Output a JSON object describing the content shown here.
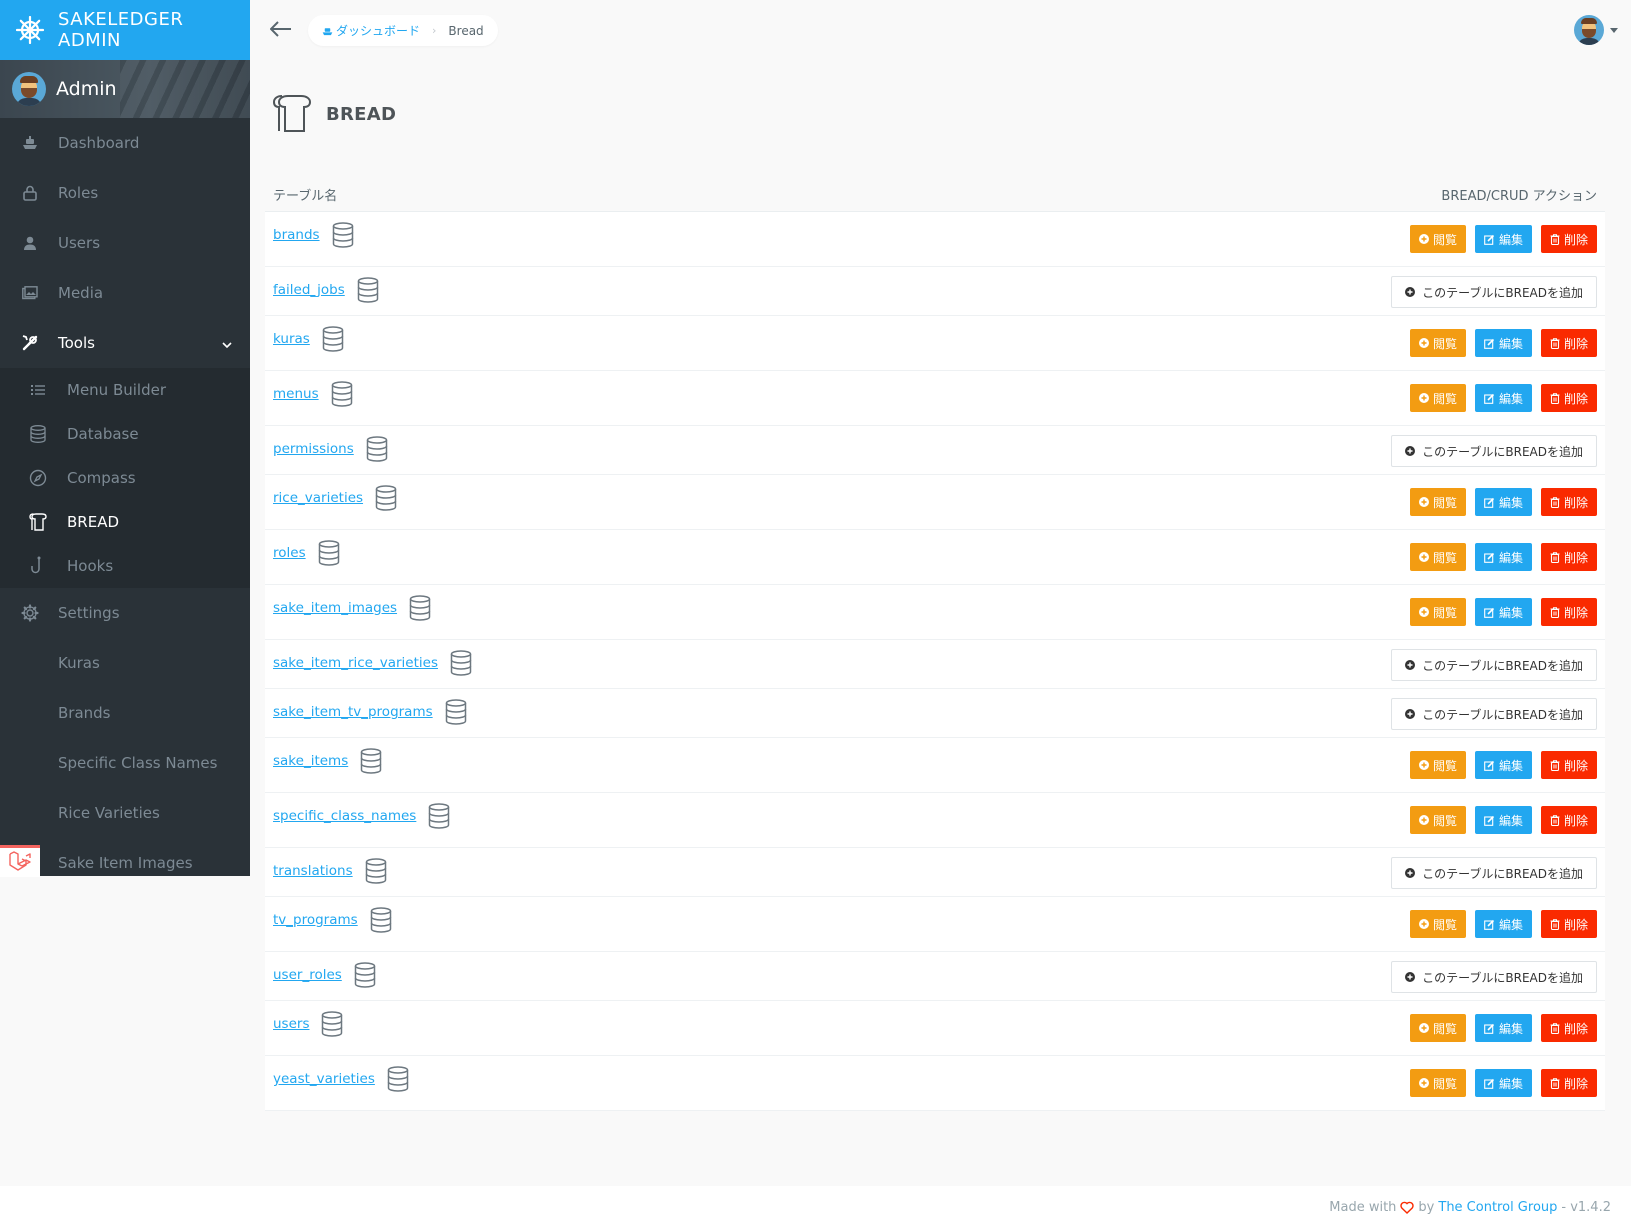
{
  "brand": {
    "title": "SAKELEDGER ADMIN"
  },
  "profile": {
    "name": "Admin"
  },
  "sidebar": {
    "items": [
      {
        "label": "Dashboard",
        "icon": "boat-icon"
      },
      {
        "label": "Roles",
        "icon": "lock-icon"
      },
      {
        "label": "Users",
        "icon": "person-icon"
      },
      {
        "label": "Media",
        "icon": "images-icon"
      },
      {
        "label": "Tools",
        "icon": "tools-icon"
      }
    ],
    "tools_sub": [
      {
        "label": "Menu Builder",
        "icon": "list-icon"
      },
      {
        "label": "Database",
        "icon": "database-icon"
      },
      {
        "label": "Compass",
        "icon": "compass-icon"
      },
      {
        "label": "BREAD",
        "icon": "bread-icon"
      },
      {
        "label": "Hooks",
        "icon": "hook-icon"
      }
    ],
    "settings": {
      "label": "Settings",
      "icon": "gear-icon"
    },
    "extra": [
      {
        "label": "Kuras"
      },
      {
        "label": "Brands"
      },
      {
        "label": "Specific Class Names"
      },
      {
        "label": "Rice Varieties"
      },
      {
        "label": "Sake Item Images"
      }
    ]
  },
  "breadcrumb": {
    "home": "ダッシュボード",
    "current": "Bread"
  },
  "page": {
    "title": "BREAD"
  },
  "table": {
    "col_name": "テーブル名",
    "col_actions": "BREAD/CRUD アクション",
    "btn_view": "閲覧",
    "btn_edit": "編集",
    "btn_delete": "削除",
    "btn_add": "このテーブルにBREADを追加",
    "rows": [
      {
        "name": "brands",
        "has_bread": true
      },
      {
        "name": "failed_jobs",
        "has_bread": false
      },
      {
        "name": "kuras",
        "has_bread": true
      },
      {
        "name": "menus",
        "has_bread": true
      },
      {
        "name": "permissions",
        "has_bread": false
      },
      {
        "name": "rice_varieties",
        "has_bread": true
      },
      {
        "name": "roles",
        "has_bread": true
      },
      {
        "name": "sake_item_images",
        "has_bread": true
      },
      {
        "name": "sake_item_rice_varieties",
        "has_bread": false
      },
      {
        "name": "sake_item_tv_programs",
        "has_bread": false
      },
      {
        "name": "sake_items",
        "has_bread": true
      },
      {
        "name": "specific_class_names",
        "has_bread": true
      },
      {
        "name": "translations",
        "has_bread": false
      },
      {
        "name": "tv_programs",
        "has_bread": true
      },
      {
        "name": "user_roles",
        "has_bread": false
      },
      {
        "name": "users",
        "has_bread": true
      },
      {
        "name": "yeast_varieties",
        "has_bread": true
      }
    ]
  },
  "footer": {
    "made_with": "Made with",
    "by": "by",
    "company": "The Control Group",
    "version": "- v1.4.2"
  },
  "colors": {
    "accent": "#22a7f0",
    "view": "#f39c12",
    "edit": "#22a7f0",
    "delete": "#fa2a00",
    "sidebar": "#2a3238"
  }
}
